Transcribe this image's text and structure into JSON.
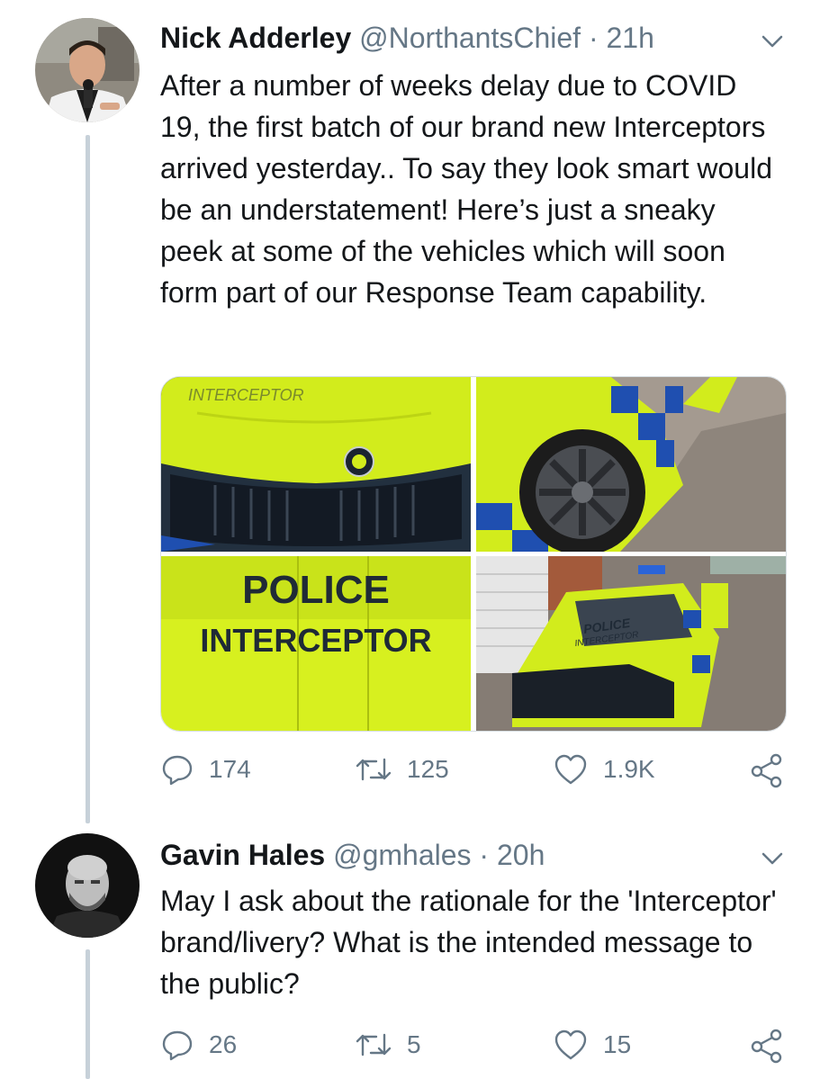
{
  "tweets": [
    {
      "name": "Nick Adderley",
      "handle": "@NorthantsChief",
      "sep": "·",
      "time": "21h",
      "text": "After a number of weeks delay due to COVID 19, the first batch of our brand new Interceptors arrived yesterday.. To say they look smart would be an understatement! Here’s just a sneaky peek at some of the vehicles which will soon form part of our Response Team capability.",
      "media": {
        "photo1_text": "INTERCEPTOR",
        "photo3_line1": "POLICE",
        "photo3_line2": "INTERCEPTOR",
        "photo4_line1": "POLICE",
        "photo4_line2": "INTERCEPTOR"
      },
      "replies": "174",
      "retweets": "125",
      "likes": "1.9K"
    },
    {
      "name": "Gavin Hales",
      "handle": "@gmhales",
      "sep": "·",
      "time": "20h",
      "text": "May I ask about the rationale for the 'Interceptor' brand/livery? What is the intended message to the public?",
      "replies": "26",
      "retweets": "5",
      "likes": "15"
    }
  ],
  "colors": {
    "accent_text": "#14171a",
    "secondary_text": "#657786",
    "thread_line": "#c7d1d9",
    "livery_yellow": "#d6f21a",
    "livery_blue": "#1f4fb0"
  },
  "icons": [
    "reply-icon",
    "retweet-icon",
    "like-icon",
    "share-icon",
    "chevron-down-icon"
  ]
}
